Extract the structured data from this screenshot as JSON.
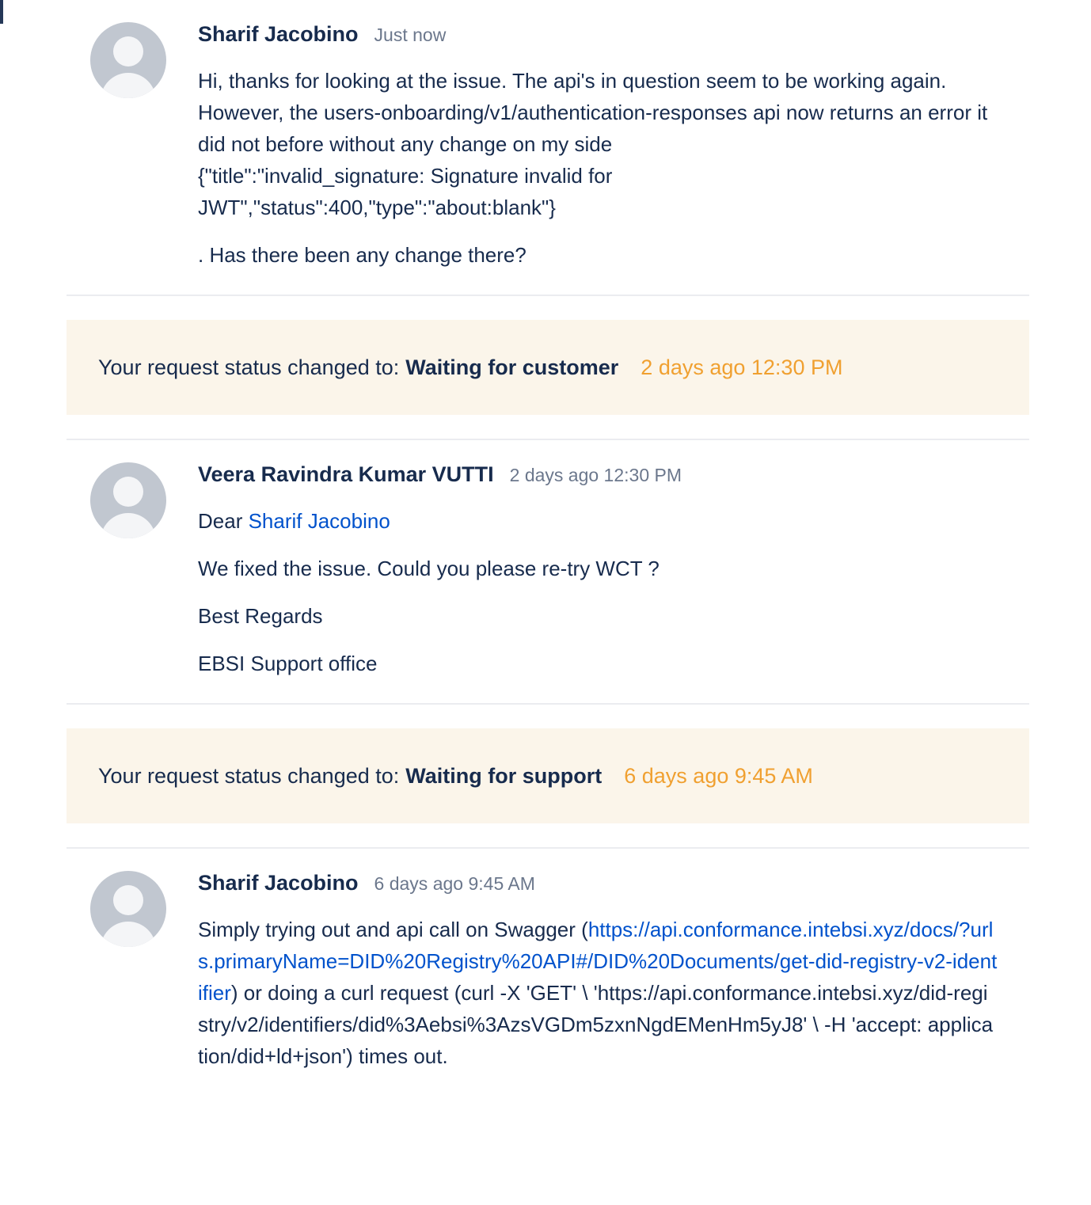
{
  "comments": [
    {
      "author": "Sharif Jacobino",
      "time": "Just now",
      "lines": [
        "Hi, thanks for looking at the issue. The api's in question seem to be working again.",
        "However, the users-onboarding/v1/authentication-responses api now returns an error it did not before without any change on my side",
        "{\"title\":\"invalid_signature: Signature invalid for JWT\",\"status\":400,\"type\":\"about:blank\"}",
        ". Has there been any change there?"
      ]
    },
    {
      "author": "Veera Ravindra Kumar VUTTI",
      "time": "2 days ago 12:30 PM",
      "greeting": "Dear ",
      "mention": "Sharif Jacobino",
      "lines": [
        "We fixed the issue. Could you please re-try WCT ?",
        "Best Regards",
        "EBSI Support office"
      ]
    },
    {
      "author": "Sharif Jacobino",
      "time": "6 days ago 9:45 AM",
      "text_before_link": "Simply trying out and api call on Swagger (",
      "link": "https://api.conformance.intebsi.xyz/docs/?urls.primaryName=DID%20Registry%20API#/DID%20Documents/get-did-registry-v2-identifier",
      "text_after_link": ") or doing a curl request (curl -X 'GET' \\ 'https://api.conformance.intebsi.xyz/did-registry/v2/identifiers/did%3Aebsi%3AzsVGDm5zxnNgdEMenHm5yJ8' \\ -H 'accept: application/did+ld+json') times out."
    }
  ],
  "status_changes": [
    {
      "label": "Your request status changed to:",
      "value": "Waiting for customer",
      "time": "2 days ago 12:30 PM"
    },
    {
      "label": "Your request status changed to:",
      "value": "Waiting for support",
      "time": "6 days ago 9:45 AM"
    }
  ]
}
